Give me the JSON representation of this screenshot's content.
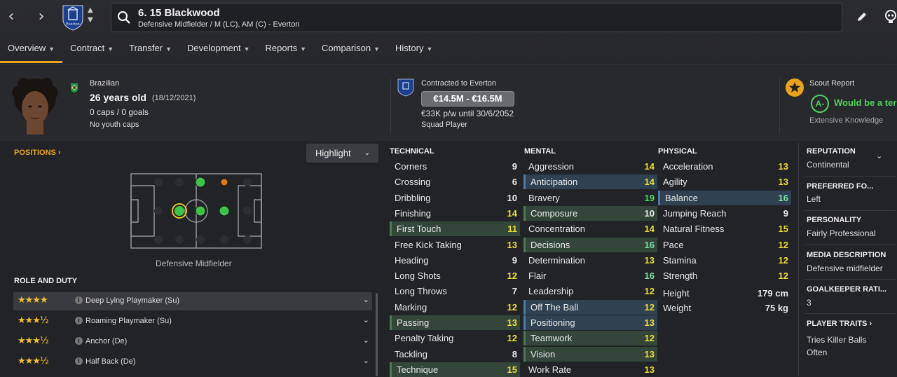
{
  "header": {
    "player_name": "6. 15 Blackwood",
    "player_subtitle": "Defensive Midfielder / M (LC), AM (C) - Everton",
    "crest_text": "Everton"
  },
  "tabs": [
    {
      "label": "Overview"
    },
    {
      "label": "Contract"
    },
    {
      "label": "Transfer"
    },
    {
      "label": "Development"
    },
    {
      "label": "Reports"
    },
    {
      "label": "Comparison"
    },
    {
      "label": "History"
    }
  ],
  "profile": {
    "nationality": "Brazilian",
    "age": "26 years old",
    "dob": "(18/12/2021)",
    "caps": "0 caps / 0 goals",
    "youth_caps": "No youth caps",
    "contract_label": "Contracted to Everton",
    "value_range": "€14.5M - €16.5M",
    "wage": "€33K p/w until 30/6/2052",
    "squad_status": "Squad Player",
    "scout_title": "Scout Report",
    "scout_grade": "A-",
    "scout_verdict": "Would be a terr",
    "scout_knowledge": "Extensive Knowledge"
  },
  "positions": {
    "title": "POSITIONS",
    "highlight_label": "Highlight",
    "position_label": "Defensive Midfielder"
  },
  "roles": {
    "title": "ROLE AND DUTY",
    "items": [
      {
        "name": "Deep Lying Playmaker (Su)",
        "stars": "★★★★"
      },
      {
        "name": "Roaming Playmaker (Su)",
        "stars": "★★★½"
      },
      {
        "name": "Anchor (De)",
        "stars": "★★★½"
      },
      {
        "name": "Half Back (De)",
        "stars": "★★★½"
      }
    ]
  },
  "attributes": {
    "technical_title": "TECHNICAL",
    "mental_title": "MENTAL",
    "physical_title": "PHYSICAL",
    "technical": [
      {
        "name": "Corners",
        "value": "9",
        "hl": "",
        "col": "v-white"
      },
      {
        "name": "Crossing",
        "value": "6",
        "hl": "",
        "col": "v-white"
      },
      {
        "name": "Dribbling",
        "value": "10",
        "hl": "",
        "col": "v-white"
      },
      {
        "name": "Finishing",
        "value": "14",
        "hl": "",
        "col": "v-yellow"
      },
      {
        "name": "First Touch",
        "value": "11",
        "hl": "hl-green",
        "col": "v-yellow"
      },
      {
        "name": "Free Kick Taking",
        "value": "13",
        "hl": "",
        "col": "v-yellow"
      },
      {
        "name": "Heading",
        "value": "9",
        "hl": "",
        "col": "v-white"
      },
      {
        "name": "Long Shots",
        "value": "12",
        "hl": "",
        "col": "v-yellow"
      },
      {
        "name": "Long Throws",
        "value": "7",
        "hl": "",
        "col": "v-white"
      },
      {
        "name": "Marking",
        "value": "12",
        "hl": "",
        "col": "v-yellow"
      },
      {
        "name": "Passing",
        "value": "13",
        "hl": "hl-green",
        "col": "v-yellow"
      },
      {
        "name": "Penalty Taking",
        "value": "12",
        "hl": "",
        "col": "v-yellow"
      },
      {
        "name": "Tackling",
        "value": "8",
        "hl": "",
        "col": "v-white"
      },
      {
        "name": "Technique",
        "value": "15",
        "hl": "hl-green",
        "col": "v-yellow"
      }
    ],
    "mental": [
      {
        "name": "Aggression",
        "value": "14",
        "hl": "",
        "col": "v-yellow"
      },
      {
        "name": "Anticipation",
        "value": "14",
        "hl": "hl-blue",
        "col": "v-yellow"
      },
      {
        "name": "Bravery",
        "value": "19",
        "hl": "",
        "col": "v-green"
      },
      {
        "name": "Composure",
        "value": "10",
        "hl": "hl-green",
        "col": "v-white"
      },
      {
        "name": "Concentration",
        "value": "14",
        "hl": "",
        "col": "v-yellow"
      },
      {
        "name": "Decisions",
        "value": "16",
        "hl": "hl-green",
        "col": "v-lgreen"
      },
      {
        "name": "Determination",
        "value": "13",
        "hl": "",
        "col": "v-yellow"
      },
      {
        "name": "Flair",
        "value": "16",
        "hl": "",
        "col": "v-lgreen"
      },
      {
        "name": "Leadership",
        "value": "12",
        "hl": "",
        "col": "v-yellow"
      },
      {
        "name": "Off The Ball",
        "value": "12",
        "hl": "hl-blue",
        "col": "v-yellow"
      },
      {
        "name": "Positioning",
        "value": "13",
        "hl": "hl-blue",
        "col": "v-yellow"
      },
      {
        "name": "Teamwork",
        "value": "12",
        "hl": "hl-green",
        "col": "v-yellow"
      },
      {
        "name": "Vision",
        "value": "13",
        "hl": "hl-green",
        "col": "v-yellow"
      },
      {
        "name": "Work Rate",
        "value": "13",
        "hl": "",
        "col": "v-yellow"
      }
    ],
    "physical": [
      {
        "name": "Acceleration",
        "value": "13",
        "hl": "",
        "col": "v-yellow"
      },
      {
        "name": "Agility",
        "value": "13",
        "hl": "",
        "col": "v-yellow"
      },
      {
        "name": "Balance",
        "value": "16",
        "hl": "hl-blue",
        "col": "v-lgreen"
      },
      {
        "name": "Jumping Reach",
        "value": "9",
        "hl": "",
        "col": "v-white"
      },
      {
        "name": "Natural Fitness",
        "value": "15",
        "hl": "",
        "col": "v-yellow"
      },
      {
        "name": "Pace",
        "value": "12",
        "hl": "",
        "col": "v-yellow"
      },
      {
        "name": "Stamina",
        "value": "12",
        "hl": "",
        "col": "v-yellow"
      },
      {
        "name": "Strength",
        "value": "12",
        "hl": "",
        "col": "v-yellow"
      },
      {
        "name": "Height",
        "value": "179 cm",
        "hl": "",
        "col": "v-white"
      },
      {
        "name": "Weight",
        "value": "75 kg",
        "hl": "",
        "col": "v-white"
      }
    ]
  },
  "side": {
    "reputation_title": "REPUTATION",
    "reputation_value": "Continental",
    "foot_title": "PREFERRED FO...",
    "foot_value": "Left",
    "personality_title": "PERSONALITY",
    "personality_value": "Fairly Professional",
    "media_title": "MEDIA DESCRIPTION",
    "media_value": "Defensive midfielder",
    "gk_title": "GOALKEEPER RATI...",
    "gk_value": "3",
    "traits_title": "PLAYER TRAITS",
    "traits_line1": "Tries Killer Balls",
    "traits_line2": "Often"
  },
  "colors": {
    "accent": "#e8a21d",
    "good_green": "#46d85a",
    "grade_green": "#4fd35a"
  }
}
